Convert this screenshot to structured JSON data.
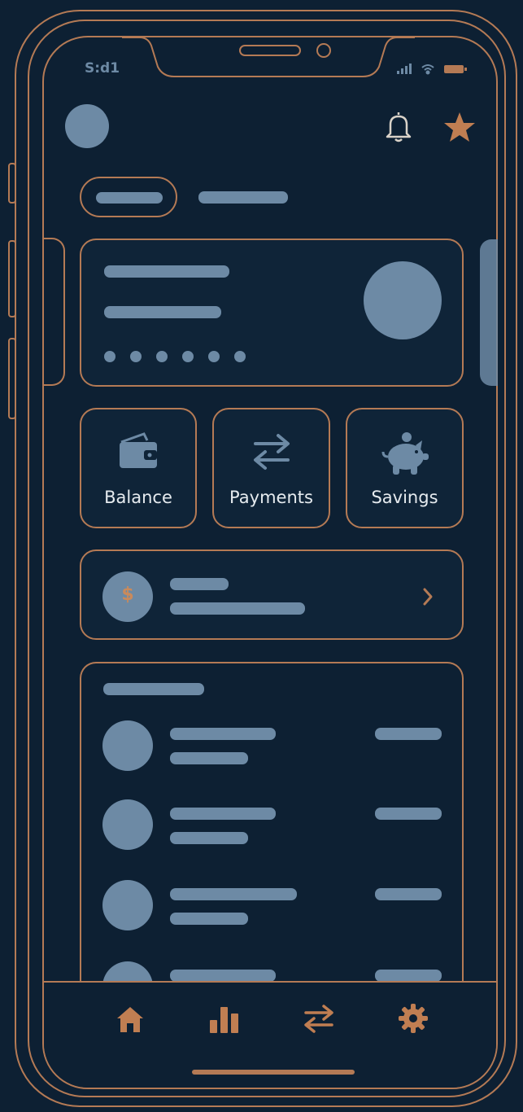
{
  "status_bar": {
    "time": "S:d1"
  },
  "quick_actions": [
    {
      "label": "Balance",
      "icon": "wallet-icon"
    },
    {
      "label": "Payments",
      "icon": "transfer-arrows-icon"
    },
    {
      "label": "Savings",
      "icon": "piggy-bank-icon"
    }
  ],
  "promo": {
    "icon": "coin-icon",
    "coin_symbol": "$"
  },
  "bottom_nav": [
    {
      "name": "home",
      "icon": "home-icon",
      "active": true
    },
    {
      "name": "stats",
      "icon": "bar-chart-icon"
    },
    {
      "name": "transfers",
      "icon": "transfer-arrows-icon"
    },
    {
      "name": "settings",
      "icon": "gear-icon"
    }
  ],
  "colors": {
    "background": "#0d2033",
    "accent_copper": "#b47a55",
    "placeholder": "#6d8aa5",
    "label_text": "#e6ebef"
  }
}
